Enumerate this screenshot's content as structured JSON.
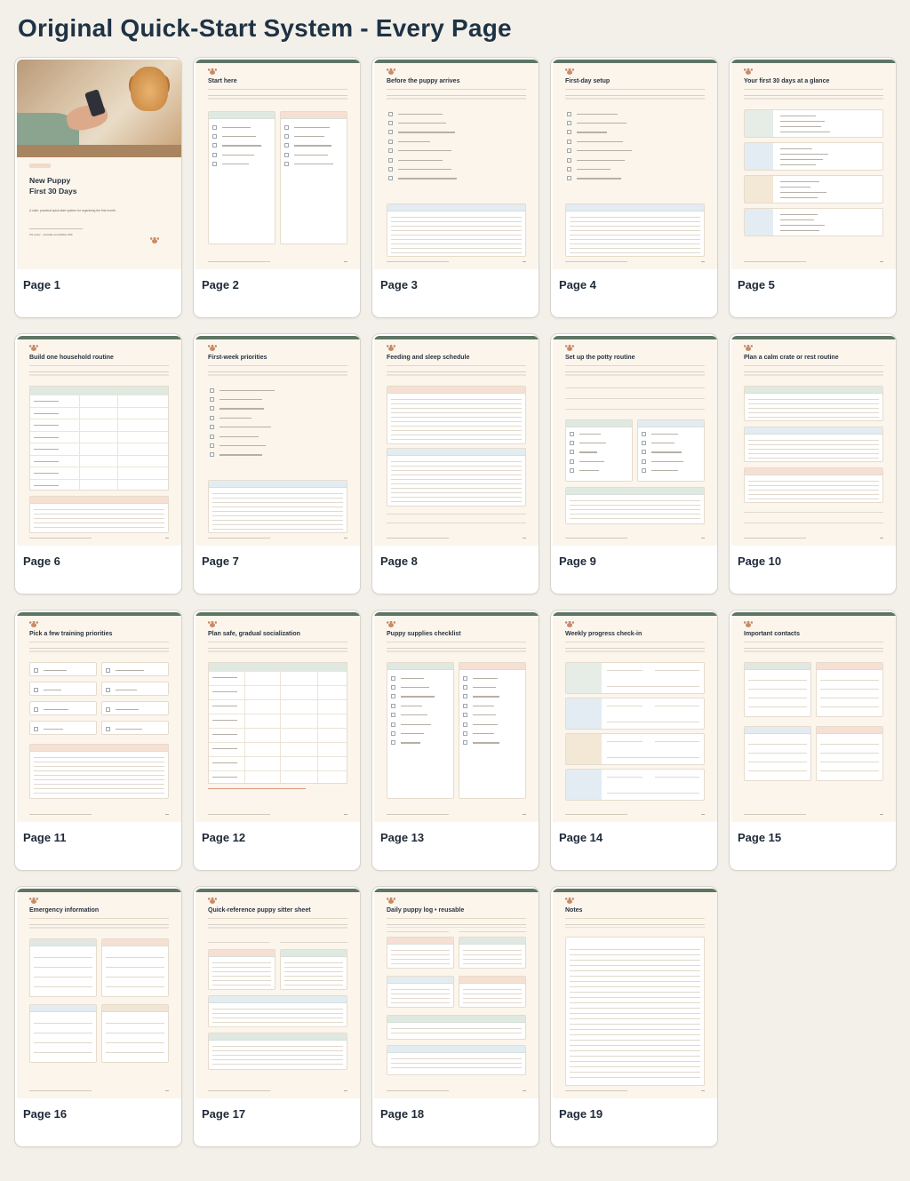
{
  "header": {
    "title": "Original Quick-Start System - Every Page"
  },
  "pages": [
    {
      "label": "Page 1",
      "cover_title_line1": "New Puppy",
      "cover_title_line2": "First 30 Days",
      "cover_subtitle": "A calm, practical quick-start system for organizing the first month.",
      "cover_meta": "US Letter · printable and fillable PDF"
    },
    {
      "label": "Page 2",
      "title": "Start here",
      "col1": "Use this system to",
      "col2": "This system does not"
    },
    {
      "label": "Page 3",
      "title": "Before the puppy arrives",
      "note": "Questions to confirm"
    },
    {
      "label": "Page 4",
      "title": "First-day setup",
      "note": "First-day notes"
    },
    {
      "label": "Page 5",
      "title": "Your first 30 days at a glance",
      "weeks": [
        "Settle in",
        "Build consistency",
        "Add gentle skills",
        "Review and refine"
      ]
    },
    {
      "label": "Page 6",
      "title": "Build one household routine",
      "cols": [
        "Routine point",
        "Time / cue",
        "Household notes"
      ]
    },
    {
      "label": "Page 7",
      "title": "First-week priorities",
      "note": "What can wait until later?"
    },
    {
      "label": "Page 8",
      "title": "Feeding and sleep schedule"
    },
    {
      "label": "Page 9",
      "title": "Set up the potty routine"
    },
    {
      "label": "Page 10",
      "title": "Plan a calm crate or rest routine"
    },
    {
      "label": "Page 11",
      "title": "Pick a few training priorities"
    },
    {
      "label": "Page 12",
      "title": "Plan safe, gradual socialization"
    },
    {
      "label": "Page 13",
      "title": "Puppy supplies checklist",
      "col1": "Daily essentials",
      "col2": "Care and records"
    },
    {
      "label": "Page 14",
      "title": "Weekly progress check-in"
    },
    {
      "label": "Page 15",
      "title": "Important contacts"
    },
    {
      "label": "Page 16",
      "title": "Emergency information"
    },
    {
      "label": "Page 17",
      "title": "Quick-reference puppy sitter sheet"
    },
    {
      "label": "Page 18",
      "title": "Daily puppy log • reusable"
    },
    {
      "label": "Page 19",
      "title": "Notes"
    }
  ],
  "colors": {
    "background": "#f3f0ea",
    "page_paper": "#fbf5ec",
    "accent_green": "#5e7563",
    "accent_peach": "#c98a67",
    "title_navy": "#1e3344"
  }
}
